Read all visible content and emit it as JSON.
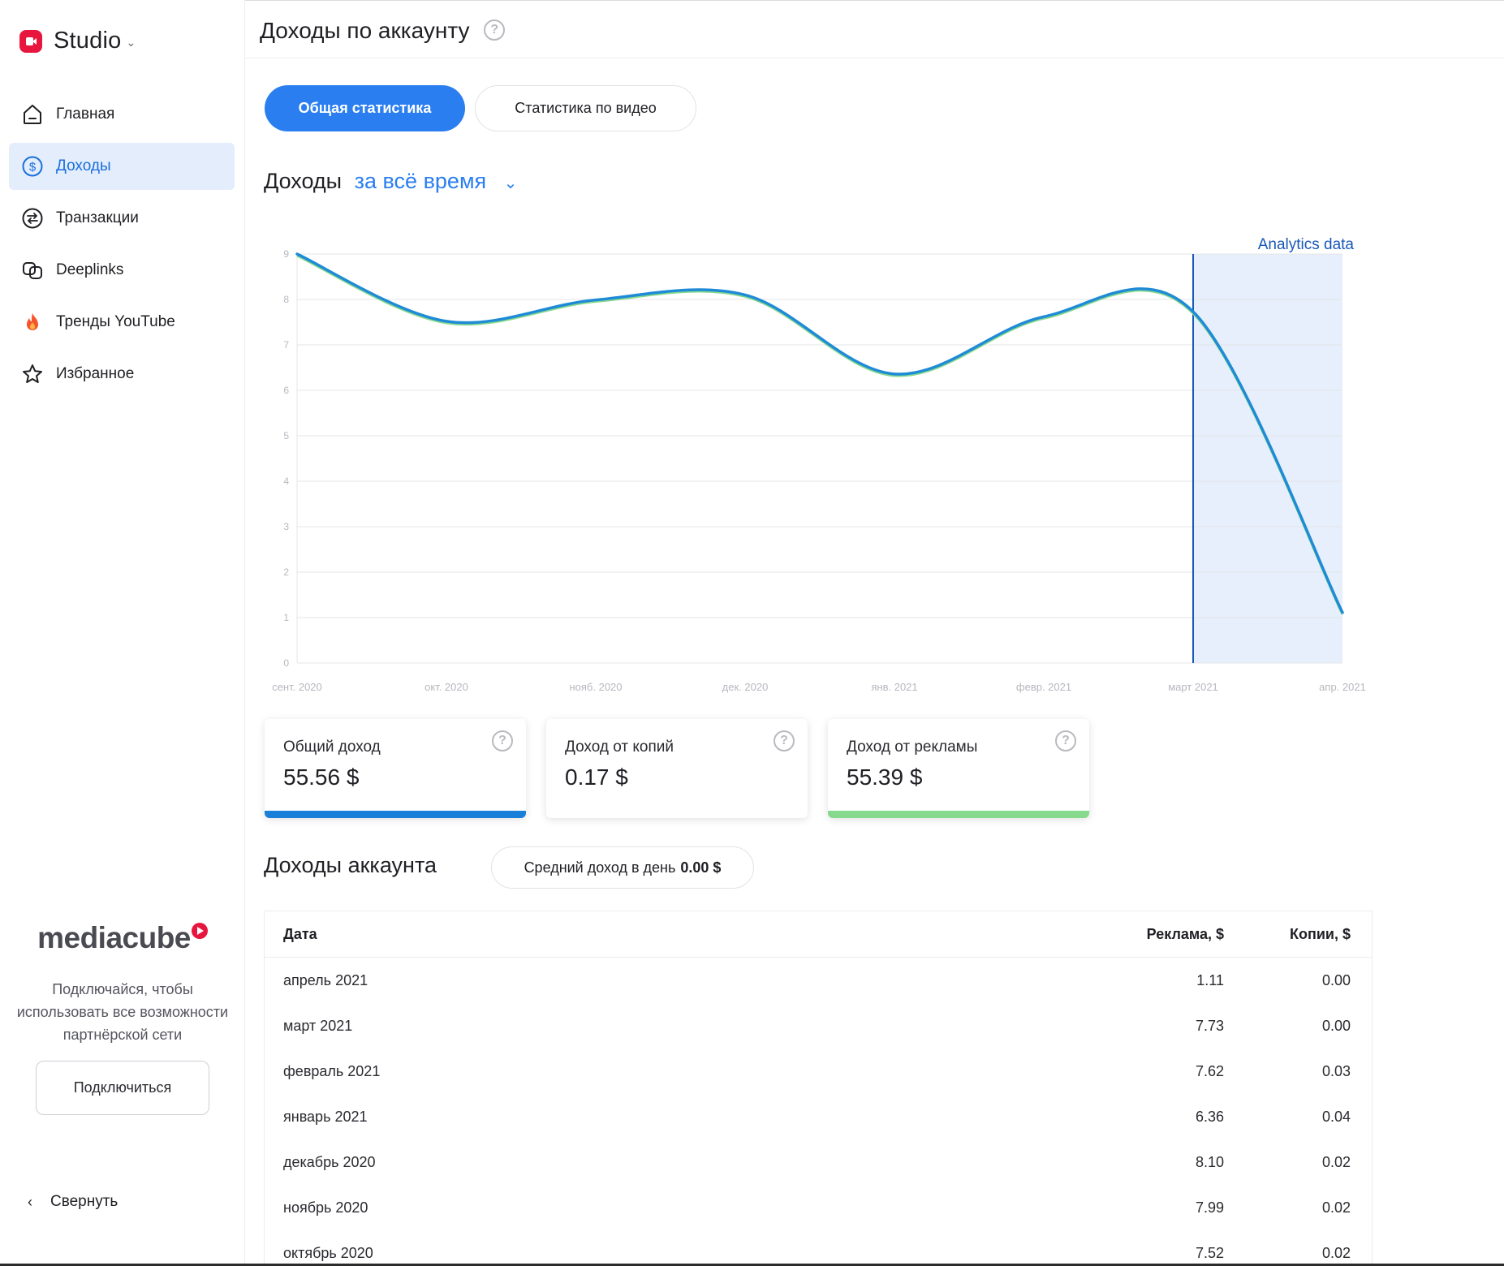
{
  "sidebar": {
    "logo_text": "Studio",
    "nav": [
      {
        "label": "Главная",
        "icon": "home-icon",
        "active": false
      },
      {
        "label": "Доходы",
        "icon": "dollar-icon",
        "active": true
      },
      {
        "label": "Транзакции",
        "icon": "transfer-icon",
        "active": false
      },
      {
        "label": "Deeplinks",
        "icon": "link-icon",
        "active": false
      },
      {
        "label": "Тренды YouTube",
        "icon": "flame-icon",
        "active": false
      },
      {
        "label": "Избранное",
        "icon": "star-icon",
        "active": false
      }
    ],
    "promo": {
      "brand": "mediacube",
      "text": "Подключайся, чтобы использовать все возможности партнёрской сети",
      "button": "Подключиться"
    },
    "collapse_label": "Свернуть"
  },
  "header": {
    "title": "Доходы по аккаунту",
    "help": "?"
  },
  "tabs": [
    {
      "label": "Общая статистика",
      "active": true
    },
    {
      "label": "Статистика по видео",
      "active": false
    }
  ],
  "income_section": {
    "title": "Доходы",
    "period": "за всё время"
  },
  "chart_data": {
    "type": "line",
    "x": [
      "сент. 2020",
      "окт. 2020",
      "нояб. 2020",
      "дек. 2020",
      "янв. 2021",
      "февр. 2021",
      "март 2021",
      "апр. 2021"
    ],
    "series": [
      {
        "values": [
          9.0,
          7.52,
          7.99,
          8.1,
          6.36,
          7.62,
          7.73,
          1.11
        ],
        "color": "#1f8bd6"
      }
    ],
    "ylim": [
      0,
      9
    ],
    "yticks": [
      "0",
      "1",
      "2",
      "3",
      "4",
      "5",
      "6",
      "7",
      "8",
      "9"
    ],
    "grid": true,
    "annotation": {
      "label": "Analytics data",
      "from": "март 2021",
      "to": "апр. 2021"
    }
  },
  "cards": [
    {
      "label": "Общий доход",
      "value": "55.56 $",
      "color": "#1a7fd8"
    },
    {
      "label": "Доход от копий",
      "value": "0.17 $",
      "color": ""
    },
    {
      "label": "Доход от рекламы",
      "value": "55.39 $",
      "color": "#86d98d"
    }
  ],
  "account": {
    "title": "Доходы аккаунта",
    "avg_label": "Средний доход в день",
    "avg_value": "0.00 $"
  },
  "table": {
    "headers": {
      "date": "Дата",
      "ads": "Реклама, $",
      "copies": "Копии, $"
    },
    "rows": [
      {
        "date": "апрель 2021",
        "ads": "1.11",
        "copies": "0.00"
      },
      {
        "date": "март 2021",
        "ads": "7.73",
        "copies": "0.00"
      },
      {
        "date": "февраль 2021",
        "ads": "7.62",
        "copies": "0.03"
      },
      {
        "date": "январь 2021",
        "ads": "6.36",
        "copies": "0.04"
      },
      {
        "date": "декабрь 2020",
        "ads": "8.10",
        "copies": "0.02"
      },
      {
        "date": "ноябрь 2020",
        "ads": "7.99",
        "copies": "0.02"
      },
      {
        "date": "октябрь 2020",
        "ads": "7.52",
        "copies": "0.02"
      }
    ]
  }
}
